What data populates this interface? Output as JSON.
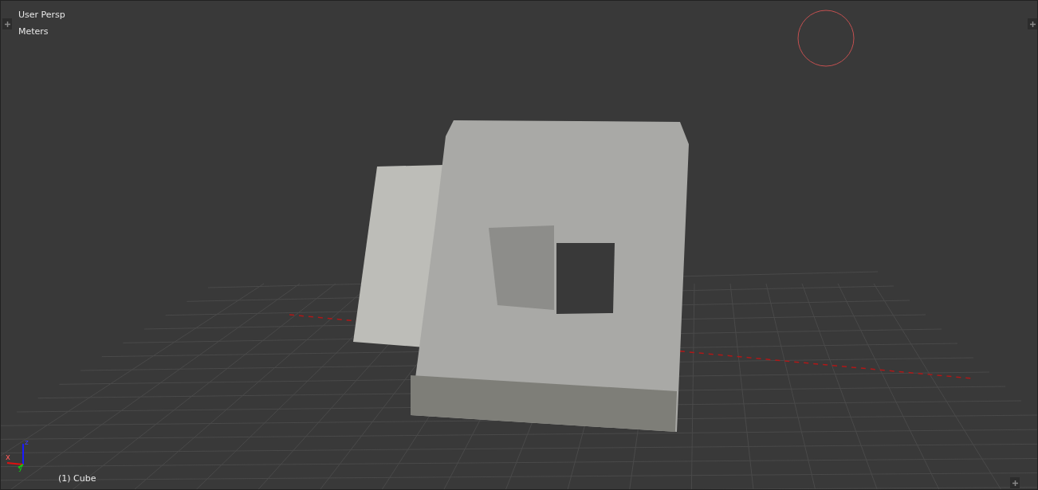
{
  "viewport": {
    "view_name": "User Persp",
    "units": "Meters",
    "object_label": "(1) Cube"
  },
  "axis_gizmo": {
    "x_label": "x",
    "y_label": "y",
    "z_label": "z"
  }
}
